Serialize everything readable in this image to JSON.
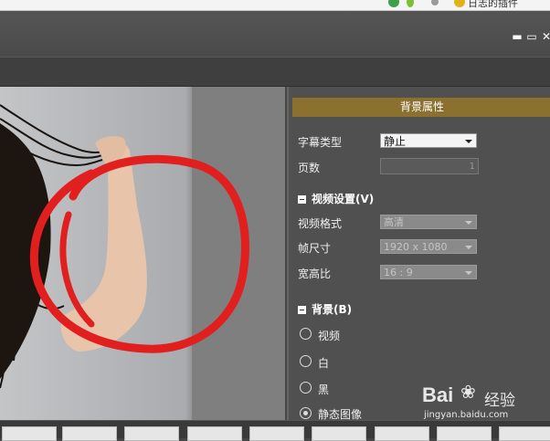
{
  "browser": {
    "status_text": "日志的插件"
  },
  "window": {
    "minimize_glyph": "▬",
    "maximize_glyph": "▭",
    "close_glyph": "✕"
  },
  "panel": {
    "title": "背景属性",
    "subtitle_type": {
      "label": "字幕类型",
      "value": "静止"
    },
    "pages": {
      "label": "页数",
      "value": "1"
    },
    "video_section": {
      "title": "视频设置(V)"
    },
    "video_format": {
      "label": "视频格式",
      "value": "高清"
    },
    "frame_size": {
      "label": "帧尺寸",
      "value": "1920 x 1080"
    },
    "aspect_ratio": {
      "label": "宽高比",
      "value": "16 : 9"
    },
    "background_section": {
      "title": "背景(B)"
    },
    "bg_options": [
      {
        "label": "视频",
        "selected": false
      },
      {
        "label": "白",
        "selected": false
      },
      {
        "label": "黑",
        "selected": false
      },
      {
        "label": "静态图像",
        "selected": true
      }
    ]
  },
  "watermark": {
    "brand": "Bai",
    "brand2": "经验",
    "url": "jingyan.baidu.com"
  },
  "colors": {
    "panel_header": "#8b7030",
    "annotation_circle": "#e21f1f"
  }
}
